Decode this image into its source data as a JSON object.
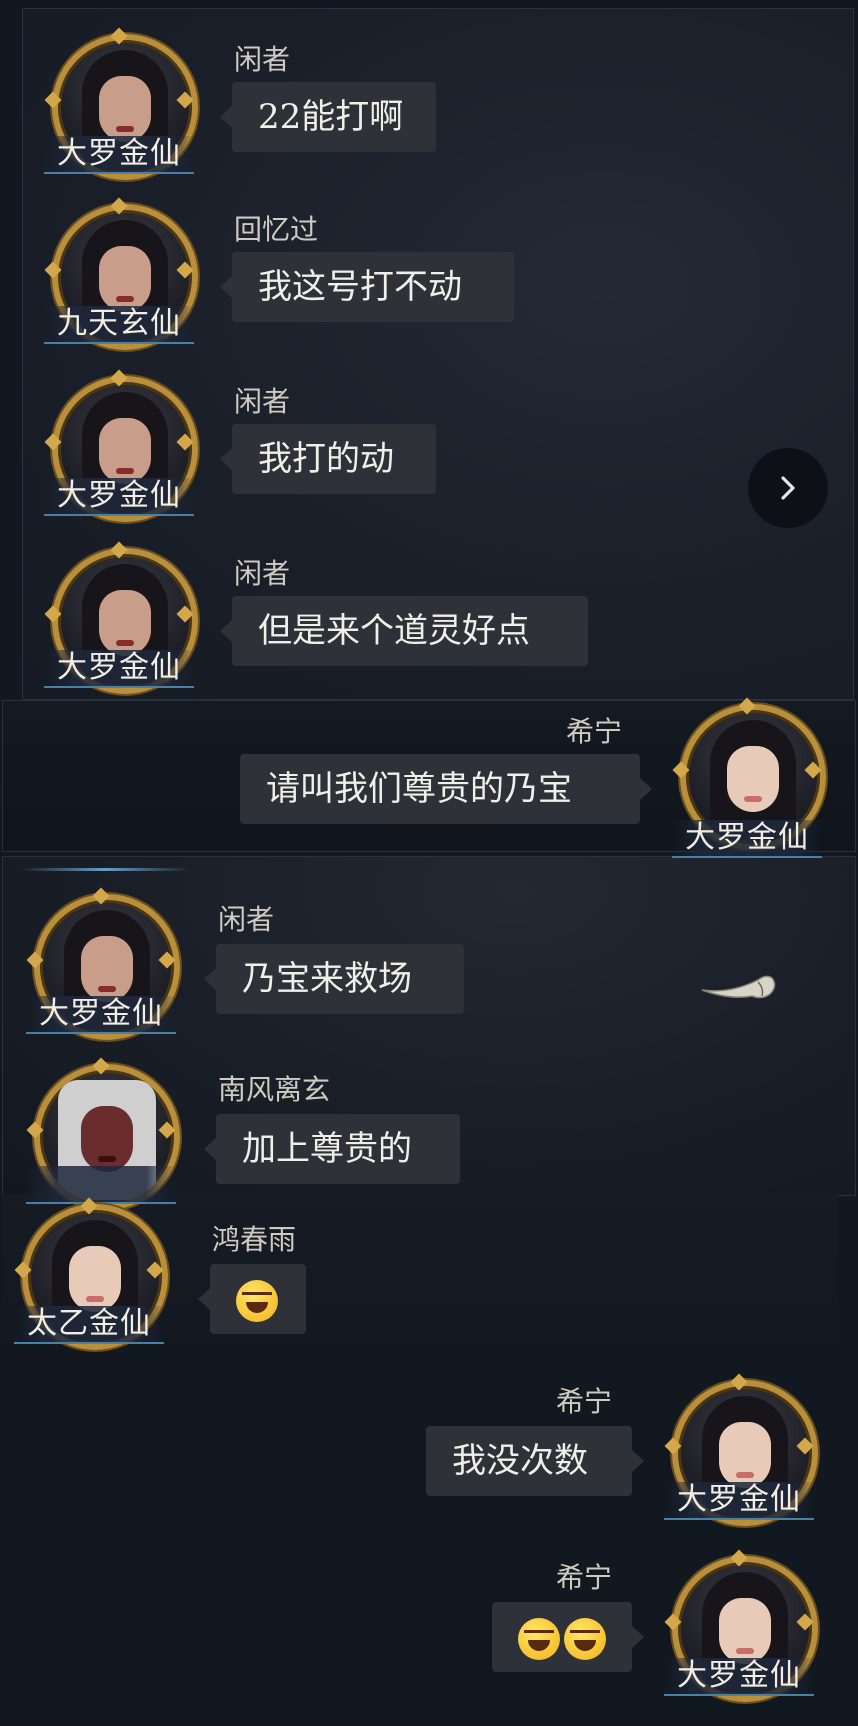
{
  "messages": [
    {
      "sender": "闲者",
      "rank": "大罗金仙",
      "text": "22能打啊",
      "side": "left",
      "avatar": "female-dark-hair-avatar"
    },
    {
      "sender": "回忆过",
      "rank": "九天玄仙",
      "text": "我这号打不动",
      "side": "left",
      "avatar": "female-dark-hair-avatar"
    },
    {
      "sender": "闲者",
      "rank": "大罗金仙",
      "text": "我打的动",
      "side": "left",
      "avatar": "female-dark-hair-avatar"
    },
    {
      "sender": "闲者",
      "rank": "大罗金仙",
      "text": "但是来个道灵好点",
      "side": "left",
      "avatar": "female-dark-hair-avatar"
    },
    {
      "sender": "希宁",
      "rank": "大罗金仙",
      "text": "请叫我们尊贵的乃宝",
      "side": "right",
      "avatar": "female-young-avatar"
    },
    {
      "sender": "闲者",
      "rank": "大罗金仙",
      "text": "乃宝来救场",
      "side": "left",
      "avatar": "female-dark-hair-avatar"
    },
    {
      "sender": "南风离玄",
      "rank": "",
      "text": "加上尊贵的",
      "side": "left",
      "avatar": "demon-white-hair-avatar"
    },
    {
      "sender": "鸿春雨",
      "rank": "太乙金仙",
      "text": "",
      "emoji_count": 1,
      "emoji": "laughing-crying-emoji",
      "side": "left",
      "avatar": "female-young-avatar"
    },
    {
      "sender": "希宁",
      "rank": "大罗金仙",
      "text": "我没次数",
      "side": "right",
      "avatar": "female-young-avatar"
    },
    {
      "sender": "希宁",
      "rank": "大罗金仙",
      "text": "",
      "emoji_count": 2,
      "emoji": "laughing-crying-emoji",
      "side": "right",
      "avatar": "female-young-avatar"
    }
  ],
  "icons": {
    "next": "chevron-right-icon",
    "horn": "horn-icon"
  },
  "colors": {
    "bubble": "#2e3238",
    "frame_gold": "#b98f3c",
    "background": "#121820"
  }
}
